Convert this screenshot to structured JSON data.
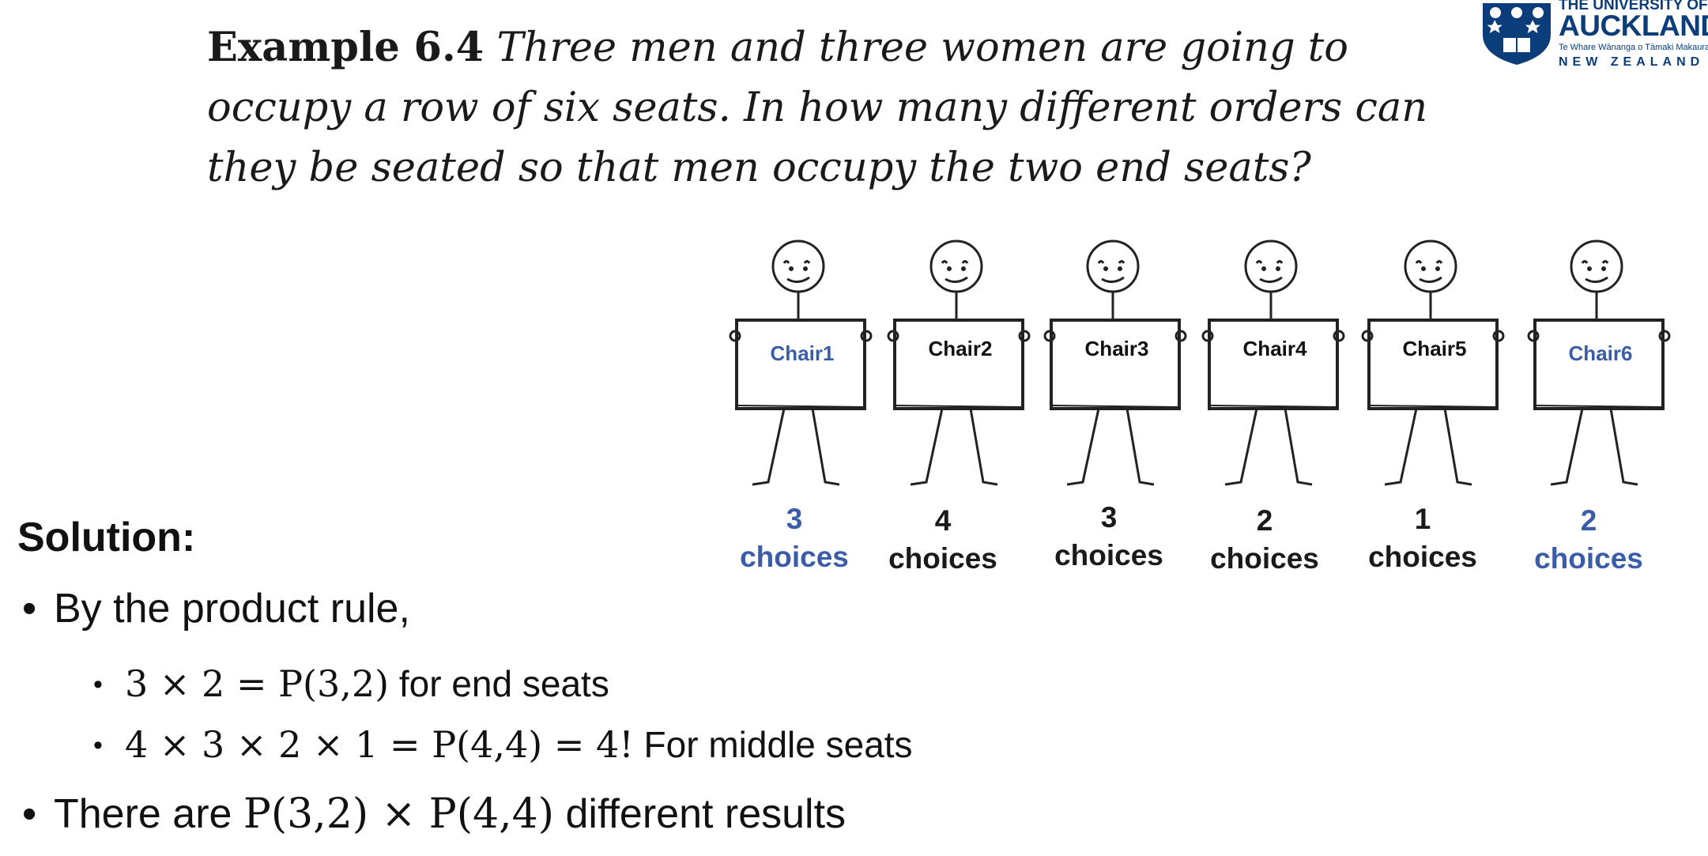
{
  "example": {
    "label": "Example 6.4",
    "text": "Three men and three women are going to occupy a row of six seats. In how many different orders can they be seated so that men occupy the two end seats?"
  },
  "logo": {
    "line1": "THE UNIVERSITY OF",
    "line2": "AUCKLAND",
    "line3": "Te Whare Wānanga o Tāmaki Makaurau",
    "line4": "NEW ZEALAND",
    "crest_color": "#0b3d7a"
  },
  "accent_color": "#3b5da8",
  "chairs": [
    {
      "label": "Chair1",
      "choices_num": "3",
      "choices_word": "choices",
      "accent": true
    },
    {
      "label": "Chair2",
      "choices_num": "4",
      "choices_word": "choices",
      "accent": false
    },
    {
      "label": "Chair3",
      "choices_num": "3",
      "choices_word": "choices",
      "accent": false
    },
    {
      "label": "Chair4",
      "choices_num": "2",
      "choices_word": "choices",
      "accent": false
    },
    {
      "label": "Chair5",
      "choices_num": "1",
      "choices_word": "choices",
      "accent": false
    },
    {
      "label": "Chair6",
      "choices_num": "2",
      "choices_word": "choices",
      "accent": true
    }
  ],
  "solution": {
    "heading": "Solution:",
    "bullet1": "By the product rule,",
    "sub1_math": "3 × 2 = P(3,2)",
    "sub1_text": " for end seats",
    "sub2_math": "4 × 3 × 2 × 1 = P(4,4) = 4!",
    "sub2_text": " For middle seats",
    "bullet2_pre": "There are ",
    "bullet2_math": "P(3,2) × P(4,4)",
    "bullet2_post": " different results"
  }
}
